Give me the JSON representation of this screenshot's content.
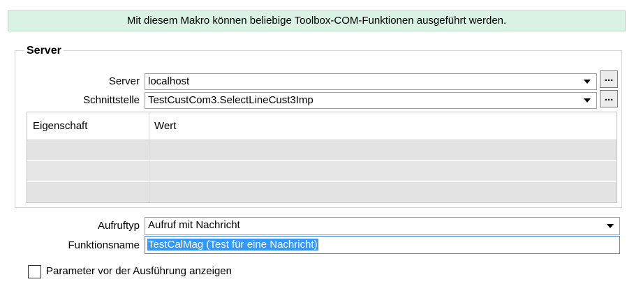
{
  "banner": {
    "text": "Mit diesem Makro können beliebige Toolbox-COM-Funktionen ausgeführt werden."
  },
  "server_group": {
    "title": "Server",
    "server": {
      "label": "Server",
      "value": "localhost",
      "browse_label": "..."
    },
    "interface": {
      "label": "Schnittstelle",
      "value": "TestCustCom3.SelectLineCust3Imp",
      "browse_label": "..."
    },
    "grid": {
      "columns": [
        "Eigenschaft",
        "Wert"
      ],
      "rows": [
        [
          "",
          ""
        ],
        [
          "",
          ""
        ],
        [
          "",
          ""
        ]
      ]
    }
  },
  "call_type": {
    "label": "Aufruftyp",
    "value": "Aufruf mit Nachricht"
  },
  "function_name": {
    "label": "Funktionsname",
    "value": "TestCalMag (Test für eine Nachricht)"
  },
  "show_params": {
    "label": "Parameter vor der Ausführung anzeigen",
    "checked": false
  }
}
